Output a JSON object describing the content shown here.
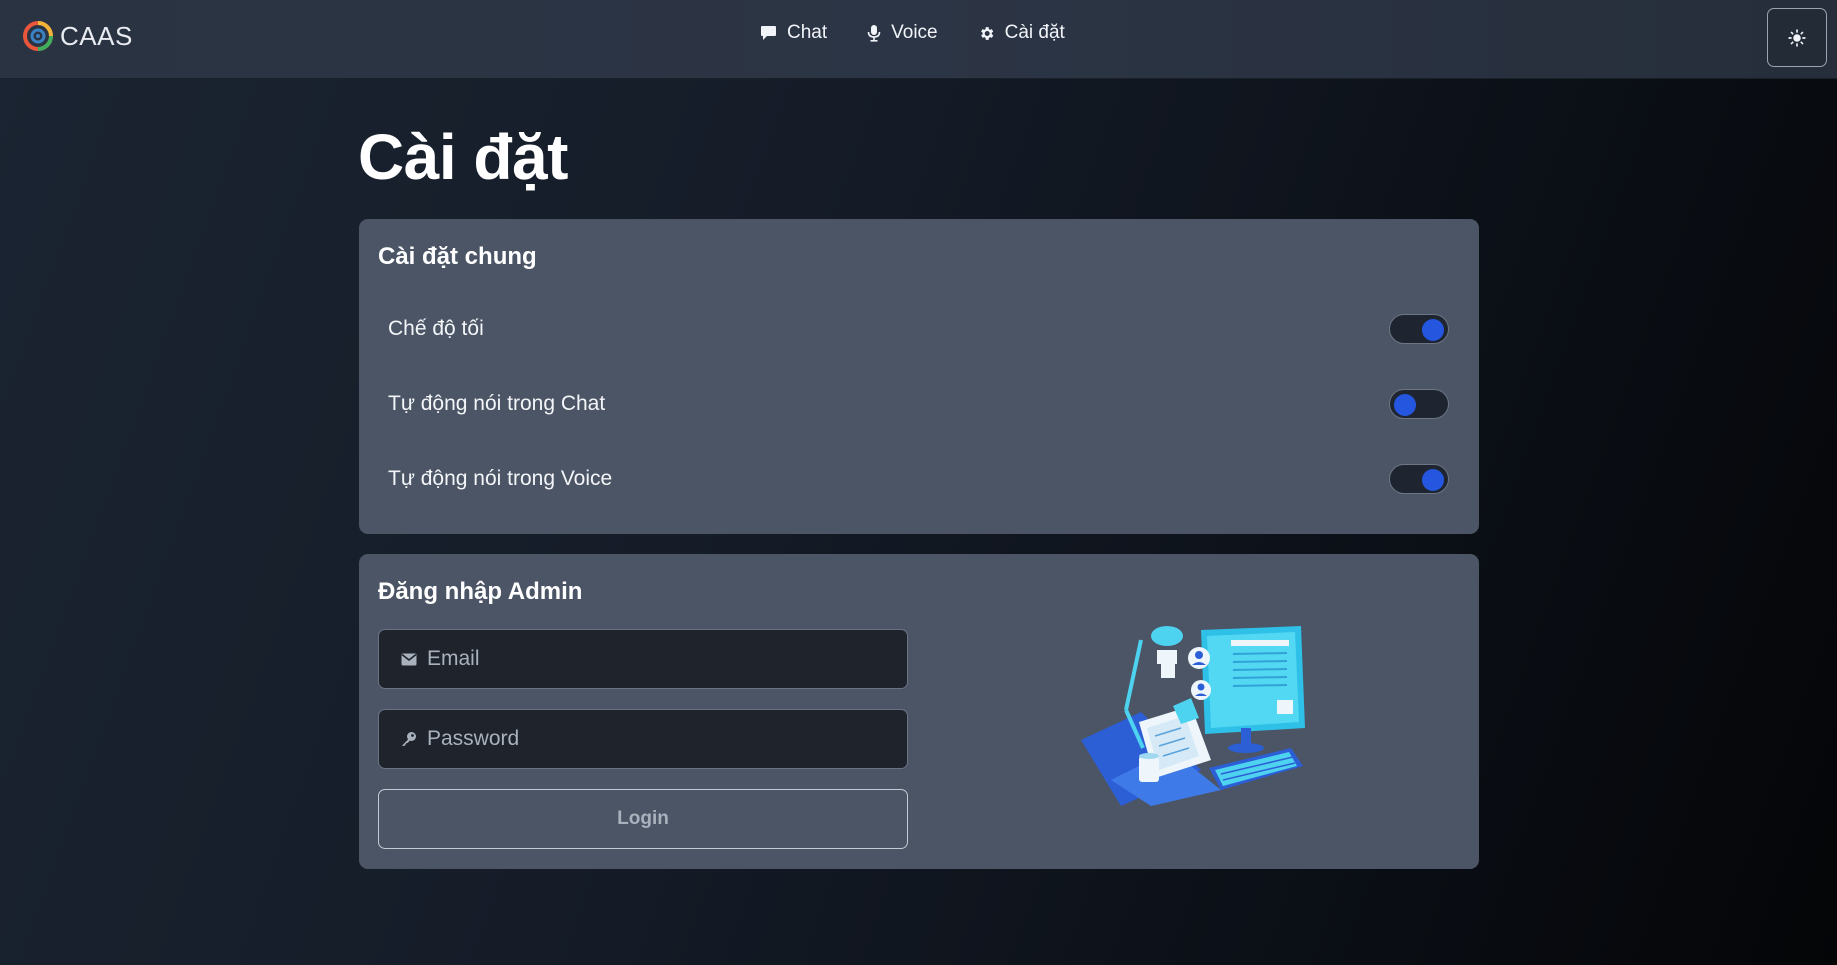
{
  "brand": {
    "name": "CAAS",
    "icon": "caas-logo-icon"
  },
  "nav": {
    "items": [
      {
        "label": "Chat",
        "icon": "chat-bubble-icon"
      },
      {
        "label": "Voice",
        "icon": "microphone-icon"
      },
      {
        "label": "Cài đặt",
        "icon": "gear-icon"
      }
    ],
    "theme_toggle_icon": "sun-icon"
  },
  "page": {
    "title": "Cài đặt"
  },
  "general": {
    "title": "Cài đặt chung",
    "settings": [
      {
        "label": "Chế độ tối",
        "enabled": true
      },
      {
        "label": "Tự động nói trong Chat",
        "enabled": false
      },
      {
        "label": "Tự động nói trong Voice",
        "enabled": true
      }
    ]
  },
  "admin": {
    "title": "Đăng nhập Admin",
    "email": {
      "placeholder": "Email",
      "value": "",
      "icon": "envelope-icon"
    },
    "password": {
      "placeholder": "Password",
      "value": "",
      "icon": "key-icon"
    },
    "login_label": "Login",
    "illustration": "workspace-illustration"
  },
  "colors": {
    "accent": "#2556e0",
    "card_bg": "#4b5565",
    "input_bg": "#1e232c"
  }
}
